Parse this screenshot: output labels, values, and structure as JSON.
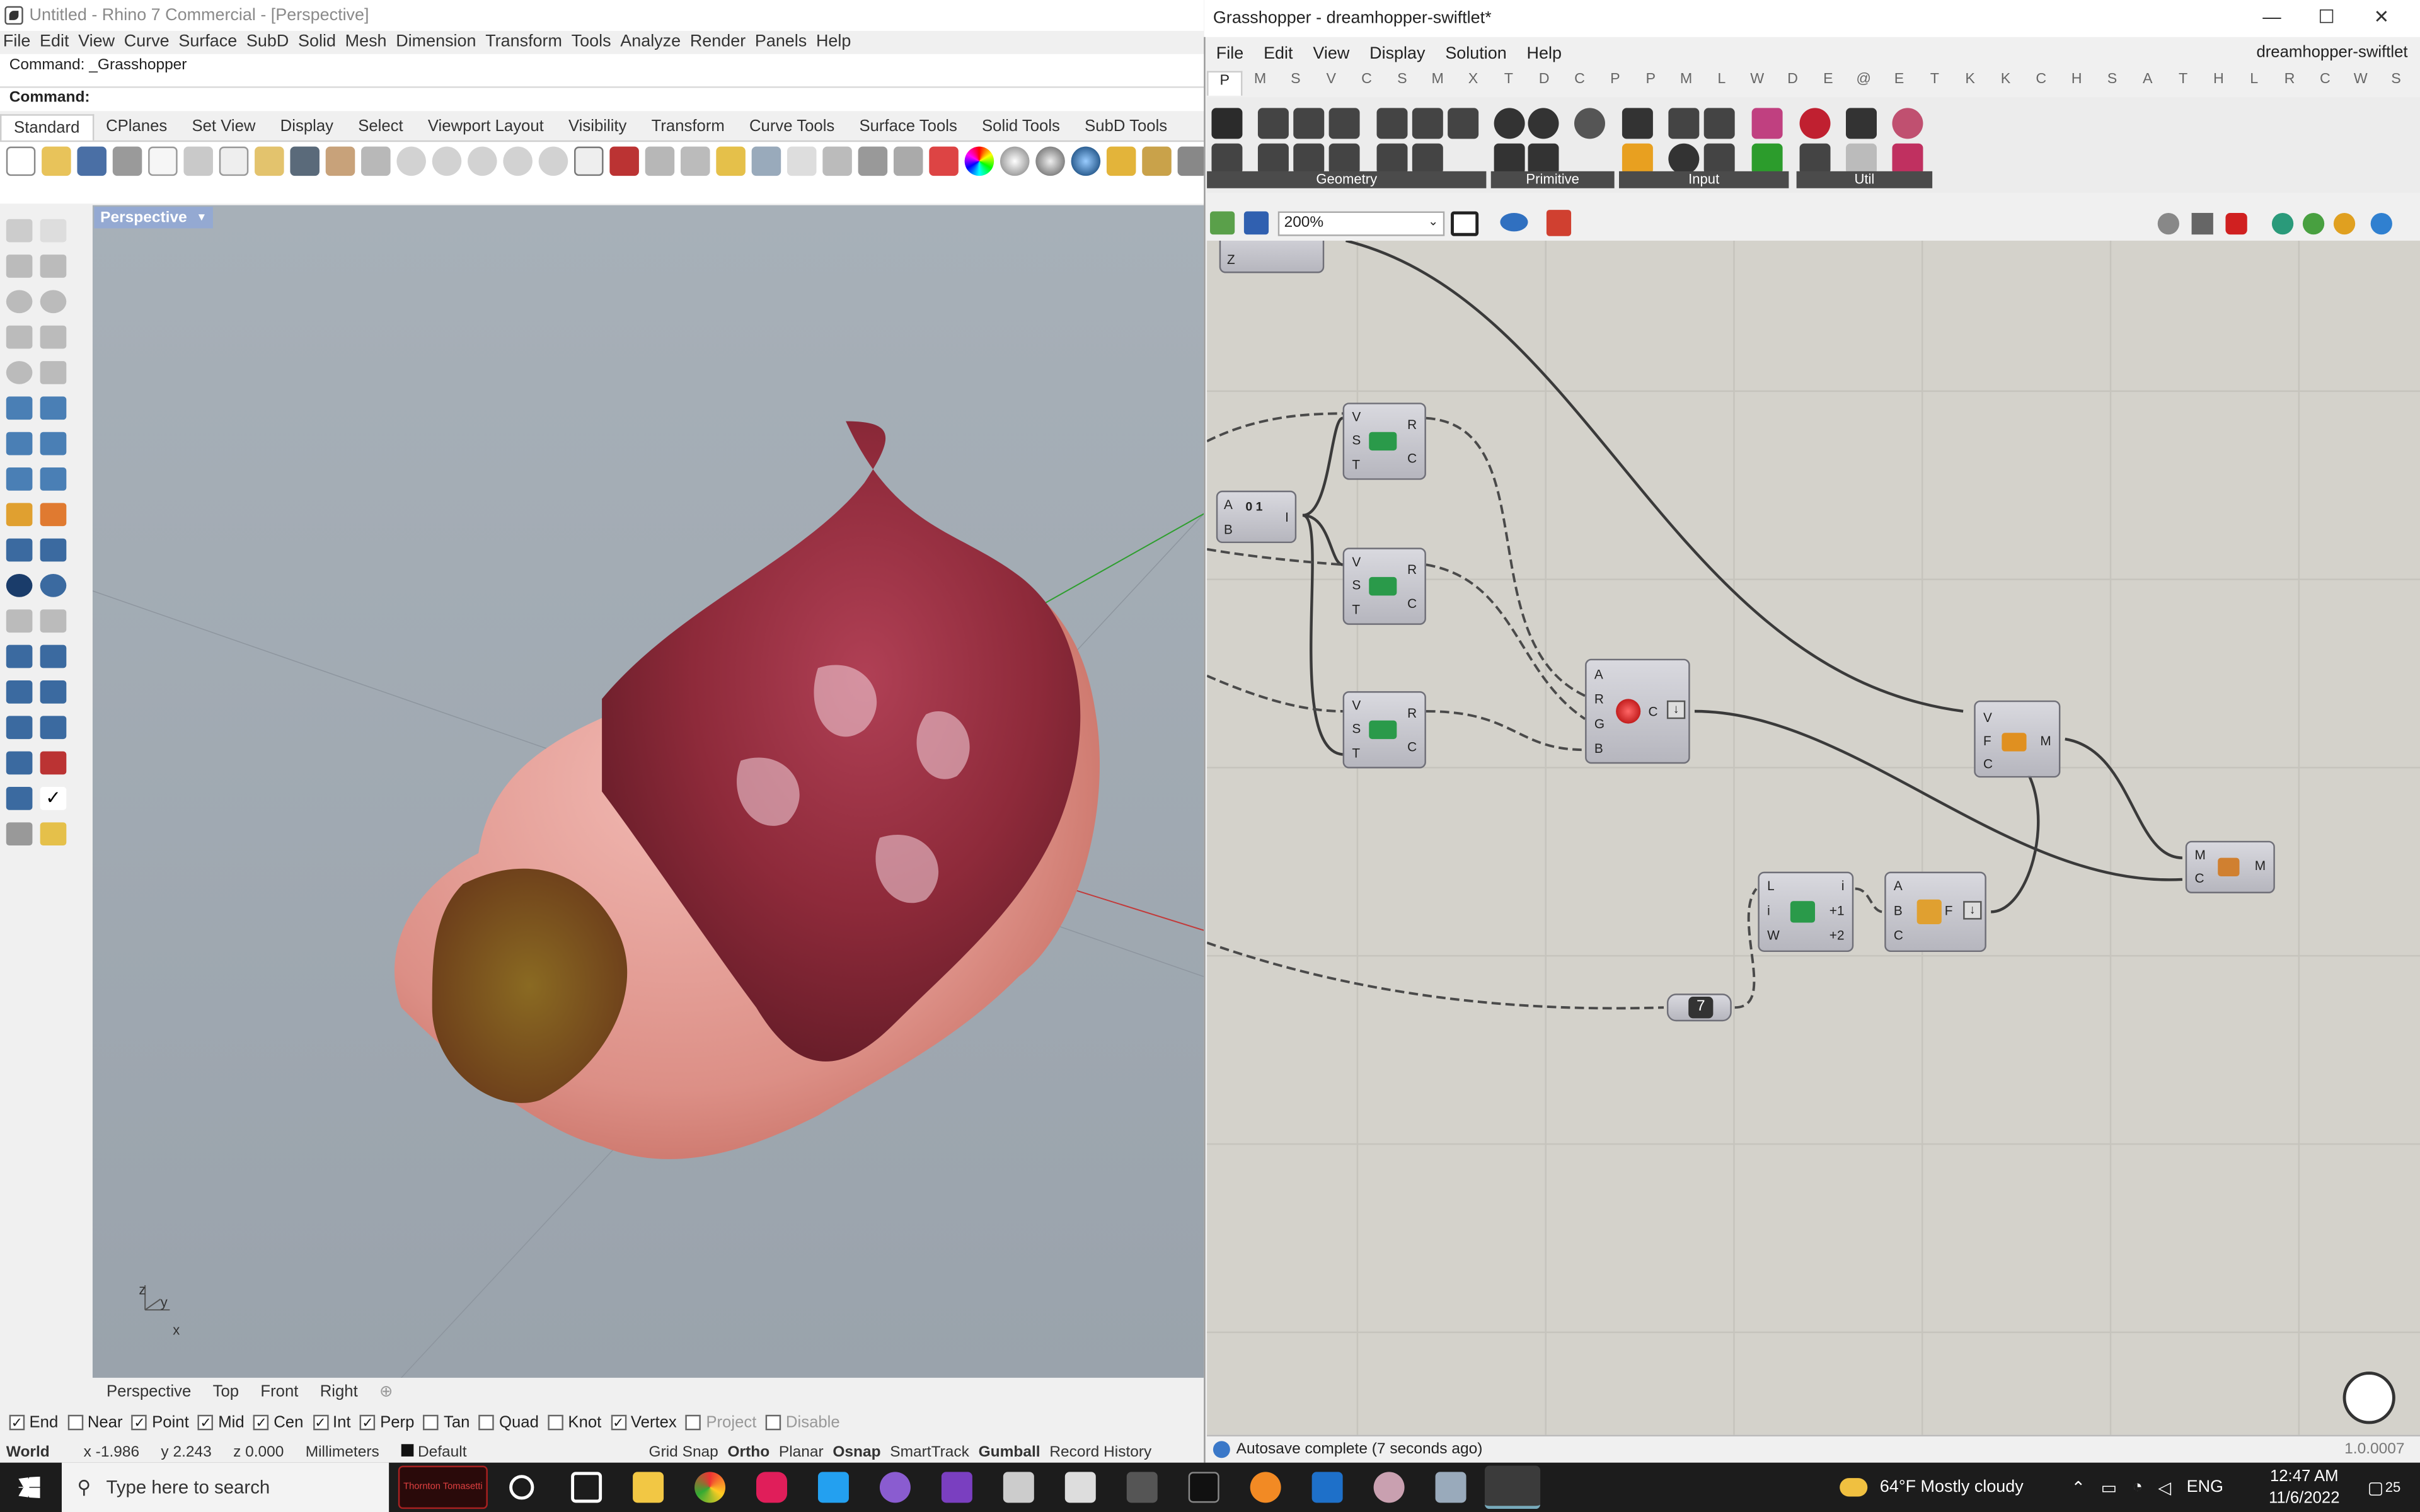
{
  "rhino": {
    "title": "Untitled - Rhino 7 Commercial - [Perspective]",
    "menu": [
      "File",
      "Edit",
      "View",
      "Curve",
      "Surface",
      "SubD",
      "Solid",
      "Mesh",
      "Dimension",
      "Transform",
      "Tools",
      "Analyze",
      "Render",
      "Panels",
      "Help"
    ],
    "command_history": "Command: _Grasshopper",
    "command_prompt": "Command:",
    "toolbar_tabs": [
      "Standard",
      "CPlanes",
      "Set View",
      "Display",
      "Select",
      "Viewport Layout",
      "Visibility",
      "Transform",
      "Curve Tools",
      "Surface Tools",
      "Solid Tools",
      "SubD Tools"
    ],
    "viewport_label": "Perspective",
    "viewport_tabs": [
      "Perspective",
      "Top",
      "Front",
      "Right"
    ],
    "axes": {
      "z": "z",
      "y": "y",
      "x": "x"
    },
    "osnaps": [
      {
        "label": "End",
        "checked": true
      },
      {
        "label": "Near",
        "checked": false
      },
      {
        "label": "Point",
        "checked": true
      },
      {
        "label": "Mid",
        "checked": true
      },
      {
        "label": "Cen",
        "checked": true
      },
      {
        "label": "Int",
        "checked": true
      },
      {
        "label": "Perp",
        "checked": true
      },
      {
        "label": "Tan",
        "checked": false
      },
      {
        "label": "Quad",
        "checked": false
      },
      {
        "label": "Knot",
        "checked": false
      },
      {
        "label": "Vertex",
        "checked": true
      },
      {
        "label": "Project",
        "checked": false,
        "disabled": true
      },
      {
        "label": "Disable",
        "checked": false,
        "disabled": true
      }
    ],
    "status": {
      "cplane": "World",
      "x": "x -1.986",
      "y": "y 2.243",
      "z": "z 0.000",
      "units": "Millimeters",
      "layer": "Default",
      "modes": [
        "Grid Snap",
        "Ortho",
        "Planar",
        "Osnap",
        "SmartTrack",
        "Gumball",
        "Record History"
      ]
    }
  },
  "grasshopper": {
    "title": "Grasshopper - dreamhopper-swiftlet*",
    "doc_name": "dreamhopper-swiftlet",
    "menu": [
      "File",
      "Edit",
      "View",
      "Display",
      "Solution",
      "Help"
    ],
    "tabs": [
      "P",
      "M",
      "S",
      "V",
      "C",
      "S",
      "M",
      "X",
      "T",
      "D",
      "C",
      "P",
      "P",
      "M",
      "L",
      "W",
      "D",
      "E",
      "@",
      "E",
      "T",
      "K",
      "K",
      "C",
      "H",
      "S",
      "A",
      "T",
      "H",
      "L",
      "R",
      "C",
      "W",
      "S"
    ],
    "ribbon_groups": [
      "Geometry",
      "Primitive",
      "Input",
      "Util"
    ],
    "zoom": "200%",
    "panel_value": "7",
    "components": {
      "top_stub": {
        "pins": [
          "Z"
        ]
      },
      "range": {
        "in": [
          "A",
          "B"
        ],
        "out": [
          "I"
        ],
        "glyph": "0 1"
      },
      "sub1": {
        "in": [
          "V",
          "S",
          "T"
        ],
        "out": [
          "R",
          "C"
        ]
      },
      "sub2": {
        "in": [
          "V",
          "S",
          "T"
        ],
        "out": [
          "R",
          "C"
        ]
      },
      "sub3": {
        "in": [
          "V",
          "S",
          "T"
        ],
        "out": [
          "R",
          "C"
        ]
      },
      "colour": {
        "in": [
          "A",
          "R",
          "G",
          "B"
        ],
        "out": [
          "C"
        ]
      },
      "mesh_col": {
        "in": [
          "V",
          "F",
          "C"
        ],
        "out": [
          "M"
        ]
      },
      "mesh_out": {
        "in": [
          "M",
          "C"
        ],
        "out": [
          "M"
        ]
      },
      "list": {
        "in": [
          "L",
          "i",
          "W"
        ],
        "out": [
          "i",
          "+1",
          "+2"
        ]
      },
      "face": {
        "in": [
          "A",
          "B",
          "C"
        ],
        "out": [
          "F"
        ]
      }
    },
    "status": "Autosave complete (7 seconds ago)",
    "version": "1.0.0007"
  },
  "taskbar": {
    "search_placeholder": "Type here to search",
    "weather": "64°F  Mostly cloudy",
    "lang": "ENG",
    "time": "12:47 AM",
    "date": "11/6/2022",
    "notif": "25",
    "app_banner": "Thornton Tomasetti"
  }
}
